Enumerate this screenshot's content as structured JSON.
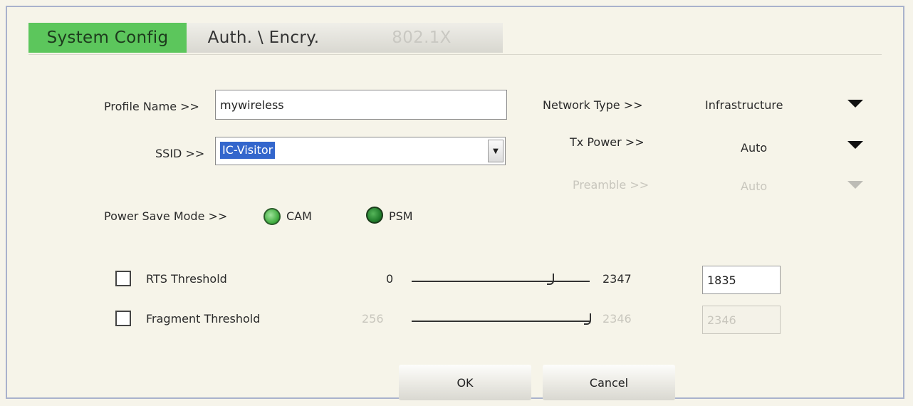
{
  "tabs": [
    {
      "label": "System Config"
    },
    {
      "label": "Auth. \\ Encry."
    },
    {
      "label": "802.1X"
    }
  ],
  "profile": {
    "label": "Profile Name >>",
    "value": "mywireless"
  },
  "ssid": {
    "label": "SSID >>",
    "value": "IC-Visitor"
  },
  "network_type": {
    "label": "Network Type >>",
    "value": "Infrastructure"
  },
  "tx_power": {
    "label": "Tx Power >>",
    "value": "Auto"
  },
  "preamble": {
    "label": "Preamble >>",
    "value": "Auto"
  },
  "power_save": {
    "label": "Power Save Mode >>",
    "options": [
      {
        "label": "CAM"
      },
      {
        "label": "PSM"
      }
    ]
  },
  "rts": {
    "label": "RTS Threshold",
    "min": "0",
    "max": "2347",
    "value": "1835"
  },
  "fragment": {
    "label": "Fragment Threshold",
    "min": "256",
    "max": "2346",
    "value": "2346"
  },
  "buttons": {
    "ok": "OK",
    "cancel": "Cancel"
  },
  "colors": {
    "active_tab": "#5cc65c",
    "selection": "#3366cc"
  }
}
